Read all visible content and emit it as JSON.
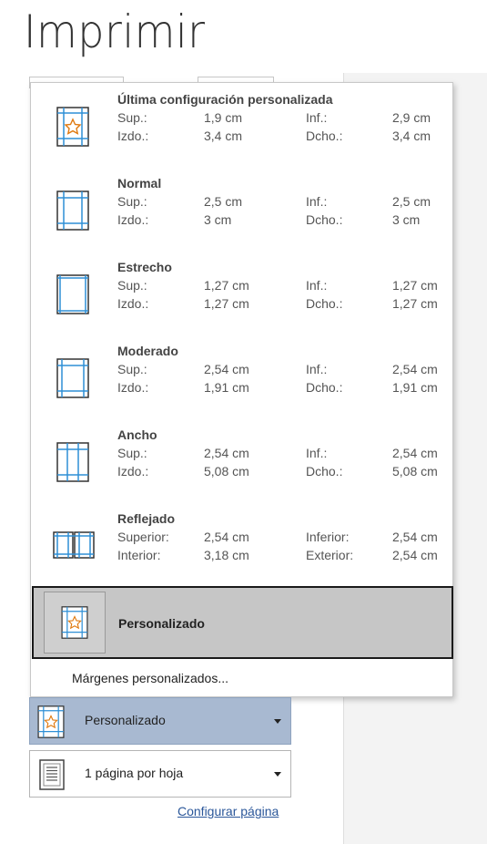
{
  "page": {
    "title": "Imprimir"
  },
  "margins_menu": {
    "options": [
      {
        "name": "Última configuración personalizada",
        "icon": "custom-margins-star-icon",
        "l1": "Sup.:",
        "v1": "1,9 cm",
        "l2": "Inf.:",
        "v2": "2,9 cm",
        "l3": "Izdo.:",
        "v3": "3,4 cm",
        "l4": "Dcho.:",
        "v4": "3,4 cm"
      },
      {
        "name": "Normal",
        "icon": "normal-margins-icon",
        "l1": "Sup.:",
        "v1": "2,5 cm",
        "l2": "Inf.:",
        "v2": "2,5 cm",
        "l3": "Izdo.:",
        "v3": "3 cm",
        "l4": "Dcho.:",
        "v4": "3 cm"
      },
      {
        "name": "Estrecho",
        "icon": "narrow-margins-icon",
        "l1": "Sup.:",
        "v1": "1,27 cm",
        "l2": "Inf.:",
        "v2": "1,27 cm",
        "l3": "Izdo.:",
        "v3": "1,27 cm",
        "l4": "Dcho.:",
        "v4": "1,27 cm"
      },
      {
        "name": "Moderado",
        "icon": "moderate-margins-icon",
        "l1": "Sup.:",
        "v1": "2,54 cm",
        "l2": "Inf.:",
        "v2": "2,54 cm",
        "l3": "Izdo.:",
        "v3": "1,91 cm",
        "l4": "Dcho.:",
        "v4": "1,91 cm"
      },
      {
        "name": "Ancho",
        "icon": "wide-margins-icon",
        "l1": "Sup.:",
        "v1": "2,54 cm",
        "l2": "Inf.:",
        "v2": "2,54 cm",
        "l3": "Izdo.:",
        "v3": "5,08 cm",
        "l4": "Dcho.:",
        "v4": "5,08 cm"
      },
      {
        "name": "Reflejado",
        "icon": "mirrored-margins-icon",
        "l1": "Superior:",
        "v1": "2,54 cm",
        "l2": "Inferior:",
        "v2": "2,54 cm",
        "l3": "Interior:",
        "v3": "3,18 cm",
        "l4": "Exterior:",
        "v4": "2,54 cm"
      }
    ],
    "selected": {
      "name": "Personalizado",
      "icon": "custom-margins-star-icon"
    },
    "custom_margins_link": "Márgenes personalizados..."
  },
  "settings": {
    "margins_dropdown": {
      "label": "Personalizado",
      "icon": "custom-margins-star-icon"
    },
    "pages_per_sheet_dropdown": {
      "label": "1 página por hoja",
      "icon": "page-per-sheet-icon"
    },
    "page_setup_link": "Configurar página"
  },
  "colors": {
    "accent_blue": "#2e8fd6",
    "star_orange": "#e07a10",
    "selected_gray": "#c6c6c6",
    "active_dropdown": "#a8b9d1",
    "link": "#2b579a"
  }
}
